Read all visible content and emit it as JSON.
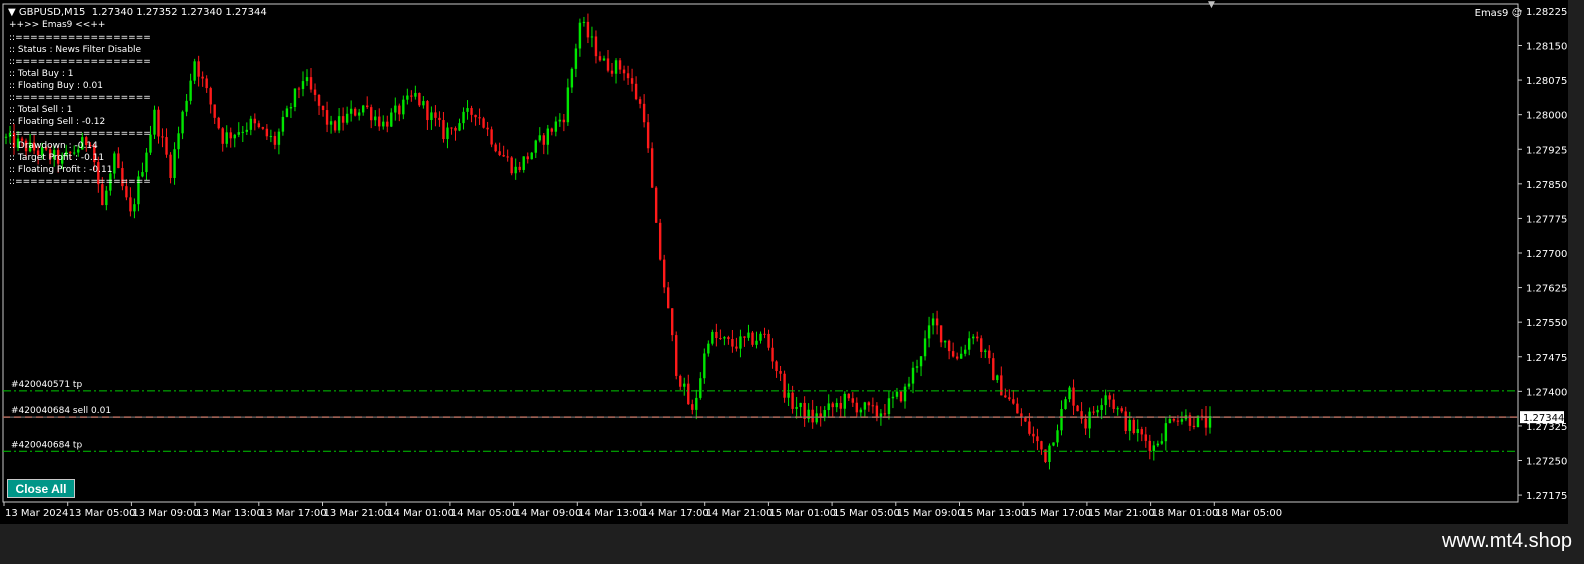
{
  "header": {
    "symbol_line": "GBPUSD,M15  1.27340 1.27352 1.27340 1.27344",
    "ea_title": "++>> Emas9 <<++",
    "ea_name": "Emas9"
  },
  "info_panel": [
    "::==================",
    ":: Status : News Filter Disable",
    "::==================",
    ":: Total Buy : 1",
    ":: Floating Buy : 0.01",
    "::==================",
    ":: Total Sell : 1",
    ":: Floating Sell : -0.12",
    "::==================",
    ":: Drawdown : -0.14",
    ":: Target Profit : -0.11",
    ":: Floating Profit : -0.11",
    "::=================="
  ],
  "close_all_button": "Close All",
  "watermark": "www.mt4.shop",
  "colors": {
    "bull": "#00e600",
    "bear": "#ff1a1a",
    "tp_line": "#00c800",
    "order_line": "#ff3c14",
    "price_label_bg": "#ffffff"
  },
  "chart_data": {
    "type": "candlestick",
    "symbol": "GBPUSD",
    "timeframe": "M15",
    "ylim": [
      1.2716,
      1.2824
    ],
    "y_ticks": [
      "1.28225",
      "1.28150",
      "1.28075",
      "1.28000",
      "1.27925",
      "1.27850",
      "1.27775",
      "1.27700",
      "1.27625",
      "1.27550",
      "1.27475",
      "1.27400",
      "1.27325",
      "1.27250",
      "1.27175"
    ],
    "x_ticks": [
      "13 Mar 2024",
      "13 Mar 05:00",
      "13 Mar 09:00",
      "13 Mar 13:00",
      "13 Mar 17:00",
      "13 Mar 21:00",
      "14 Mar 01:00",
      "14 Mar 05:00",
      "14 Mar 09:00",
      "14 Mar 13:00",
      "14 Mar 17:00",
      "14 Mar 21:00",
      "15 Mar 01:00",
      "15 Mar 05:00",
      "15 Mar 09:00",
      "15 Mar 13:00",
      "15 Mar 17:00",
      "15 Mar 21:00",
      "18 Mar 01:00",
      "18 Mar 05:00"
    ],
    "current_price": "1.27344",
    "order_lines": [
      {
        "label": "#420040571 tp",
        "price": 1.27401,
        "kind": "tp"
      },
      {
        "label": "#420040684 sell 0.01",
        "price": 1.27344,
        "kind": "order"
      },
      {
        "label": "#420040684 tp",
        "price": 1.2727,
        "kind": "tp"
      }
    ],
    "waypoints": [
      [
        0,
        1.2795
      ],
      [
        15,
        1.279
      ],
      [
        22,
        1.2795
      ],
      [
        25,
        1.278
      ],
      [
        28,
        1.279
      ],
      [
        32,
        1.2778
      ],
      [
        38,
        1.28
      ],
      [
        42,
        1.2788
      ],
      [
        48,
        1.2812
      ],
      [
        55,
        1.2795
      ],
      [
        62,
        1.2798
      ],
      [
        68,
        1.2794
      ],
      [
        75,
        1.2808
      ],
      [
        82,
        1.2797
      ],
      [
        90,
        1.2802
      ],
      [
        95,
        1.2798
      ],
      [
        103,
        1.2804
      ],
      [
        110,
        1.2796
      ],
      [
        118,
        1.2801
      ],
      [
        124,
        1.2792
      ],
      [
        128,
        1.2788
      ],
      [
        135,
        1.2795
      ],
      [
        140,
        1.28
      ],
      [
        144,
        1.282
      ],
      [
        150,
        1.2811
      ],
      [
        155,
        1.281
      ],
      [
        160,
        1.28
      ],
      [
        163,
        1.2775
      ],
      [
        168,
        1.2745
      ],
      [
        172,
        1.2735
      ],
      [
        176,
        1.2752
      ],
      [
        182,
        1.275
      ],
      [
        190,
        1.2752
      ],
      [
        196,
        1.2738
      ],
      [
        202,
        1.2734
      ],
      [
        210,
        1.2738
      ],
      [
        218,
        1.2735
      ],
      [
        225,
        1.274
      ],
      [
        232,
        1.2755
      ],
      [
        238,
        1.2747
      ],
      [
        242,
        1.2753
      ],
      [
        248,
        1.2742
      ],
      [
        254,
        1.2734
      ],
      [
        260,
        1.2726
      ],
      [
        266,
        1.274
      ],
      [
        270,
        1.2733
      ],
      [
        275,
        1.274
      ],
      [
        280,
        1.2733
      ],
      [
        287,
        1.2728
      ],
      [
        292,
        1.2735
      ],
      [
        300,
        1.2733
      ]
    ]
  }
}
